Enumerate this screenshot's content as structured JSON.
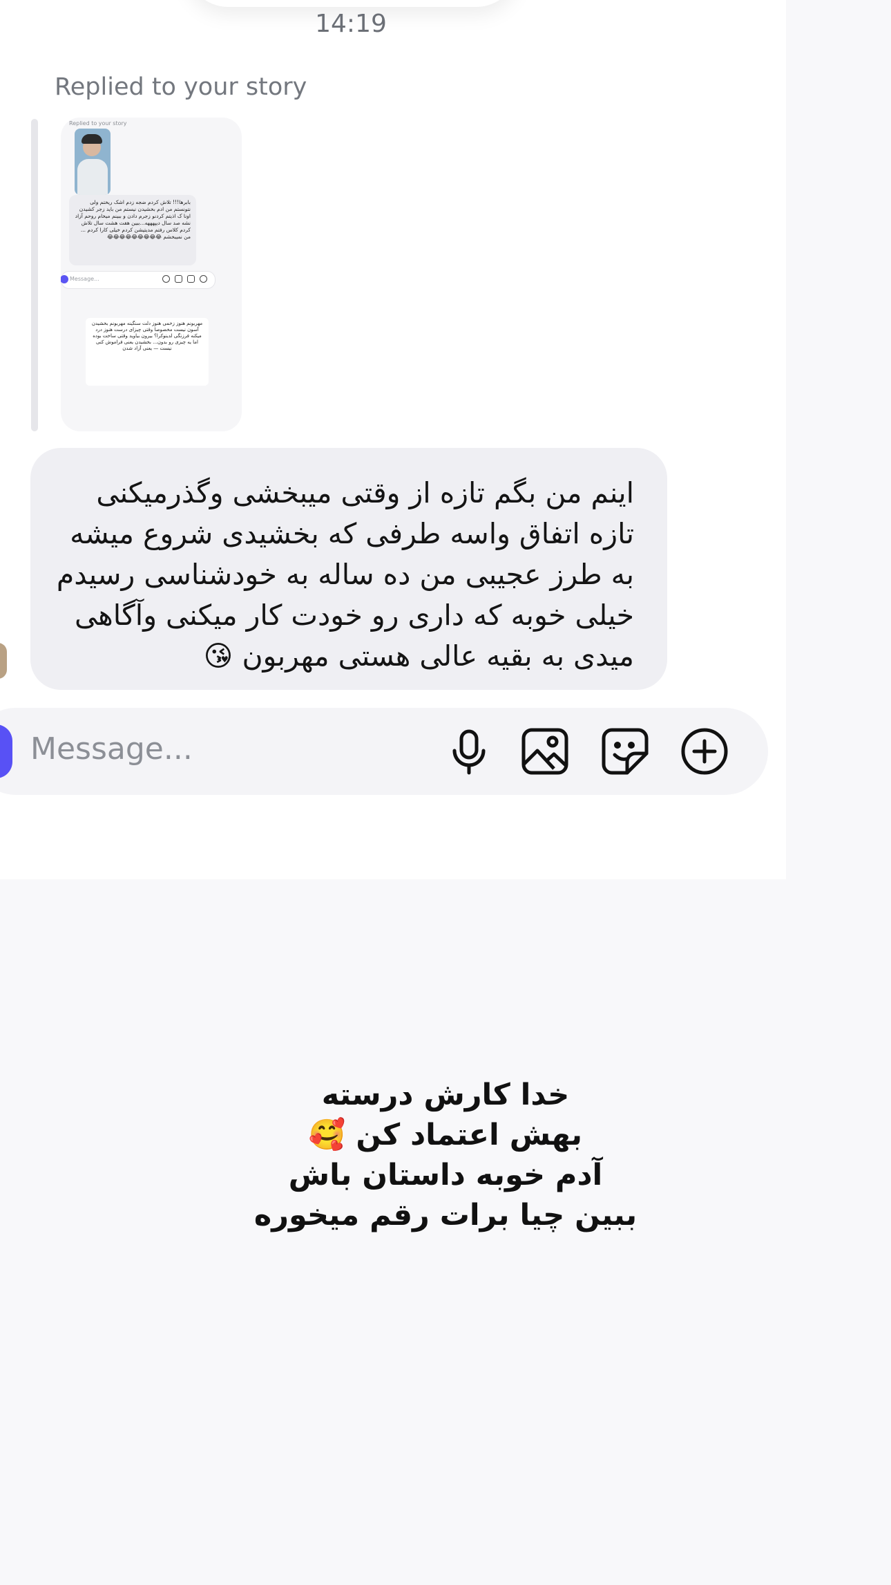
{
  "chat": {
    "timestamp": "14:19",
    "reply_label": "Replied to your story",
    "story_preview": {
      "mini_label": "Replied to your story",
      "mini_text": "بابرها!!! تلاش کردم ضجه زدم اشک ریختم ولی نتونستم من ادم بخشیدن نیستم من باید زجر کشیدن اونا ک اذیتم کردنو زجرم دادن و ببینم میخام روحم آزاد نشه صد سال دیپهههه...ببین هفت هشت سال تلاش کردم کلاس رفتم مدیتیشن کردم خیلی کارا کردم ... من نمیبخشم 😂😂😂😂😂😂😂😂😂",
      "mini_placeholder": "Message...",
      "mini_note": "مهربونم هنوز زخمی هنوز دلت سنگینه مهربونم بخشیدن آسون نیست مخصوصا وقتی چیزای درست هنوز درد میکنه فرزنگی لدینوکرا؟ بیرون بیاوید وقتی ساخت بوده اما یه چیزی رو بدون... بخشیدن یعنی فراموش کنی نیست — یعنی آزاد شدن"
    },
    "message_text": "اینم من بگم تازه از وقتی میبخشی وگذرمیکنی تازه اتفاق واسه طرفی که بخشیدی شروع میشه به طرز عجیبی من ده ساله به خودشناسی رسیدم خیلی خوبه که داری رو خودت کار میکنی وآگاهی میدی به بقیه عالی هستی مهربون 😘"
  },
  "composer": {
    "placeholder": "Message...",
    "icons": [
      "microphone-icon",
      "image-icon",
      "sticker-icon",
      "plus-circle-icon"
    ]
  },
  "caption": {
    "line1": "خدا کارش درسته",
    "line2": "بهش اعتماد کن 🥰",
    "line3": "آدم خوبه داستان باش",
    "line4": "ببین چیا برات رقم میخوره"
  },
  "colors": {
    "accent": "#5851f5",
    "bubble": "#efeff3",
    "background": "#f8f8fa"
  }
}
